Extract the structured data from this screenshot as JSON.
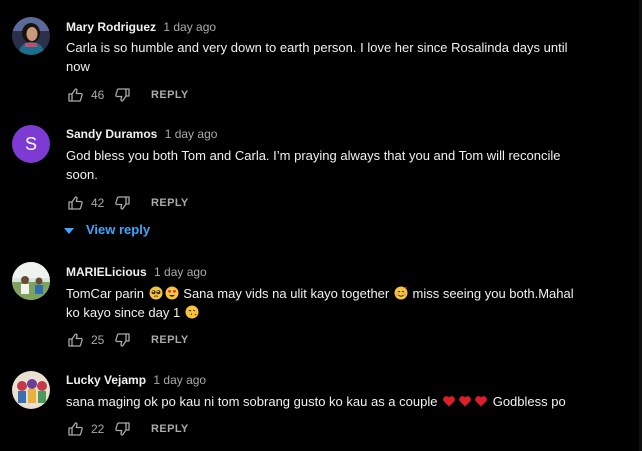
{
  "colors": {
    "background": "#000000",
    "text": "#f1f1f1",
    "muted": "#aaaaaa",
    "link": "#3ea6ff",
    "avatar_letter_bg": "#7e3bd3"
  },
  "comments": [
    {
      "author": "Mary Rodriguez",
      "time": "1 day ago",
      "avatar": "photo-avatar",
      "text_lines": [
        "Carla is so humble and very down to earth person. I love her since Rosalinda days until",
        "now"
      ],
      "likes": "46",
      "reply_label": "REPLY"
    },
    {
      "author": "Sandy Duramos",
      "time": "1 day ago",
      "avatar_letter": "S",
      "text_lines": [
        "God bless you both Tom and Carla. I’m praying always that you and Tom will reconcile",
        "soon."
      ],
      "likes": "42",
      "reply_label": "REPLY",
      "view_replies_label": "View reply"
    },
    {
      "author": "MARIELicious",
      "time": "1 day ago",
      "avatar": "photo-avatar",
      "text_parts": {
        "a": "TomCar parin",
        "b": "Sana may vids na ulit kayo together",
        "c": "miss seeing you both.Mahal",
        "d": "ko kayo since day 1"
      },
      "likes": "25",
      "reply_label": "REPLY"
    },
    {
      "author": "Lucky Vejamp",
      "time": "1 day ago",
      "avatar": "photo-avatar",
      "text_parts": {
        "a": "sana maging ok po kau ni tom sobrang gusto ko kau as a couple",
        "b": "Godbless po"
      },
      "likes": "22",
      "reply_label": "REPLY"
    }
  ]
}
